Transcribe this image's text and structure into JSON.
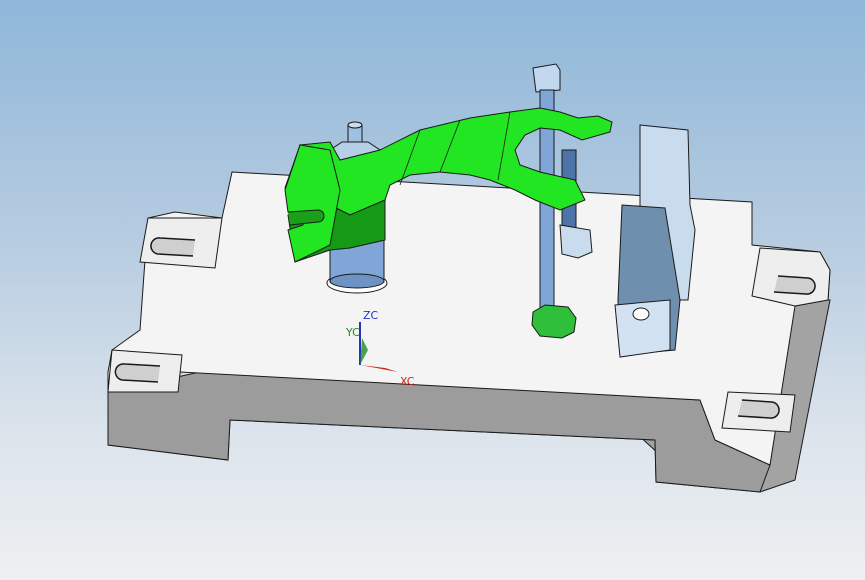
{
  "viewport": {
    "name": "3d-graphics-viewport",
    "background_top": "#8fb7d9",
    "background_bottom": "#eef0f2"
  },
  "model": {
    "colors": {
      "baseplate_top": "#f4f4f4",
      "baseplate_side": "#a3a3a3",
      "fork_part": "#22e622",
      "fork_part_dark": "#159a15",
      "pins": "#7fa6d6",
      "pins_dark": "#4d74a8",
      "nut": "#2fbf3b",
      "support_block": "#b7cfe6",
      "support_block_dark": "#6f8fae",
      "edge": "#1a1a1a"
    }
  },
  "triad": {
    "zc_label": "ZC",
    "yc_label": "YC",
    "xc_label": "XC",
    "zc_color": "#2233cc",
    "yc_color": "#1f8f1f",
    "xc_color": "#cc2222"
  }
}
